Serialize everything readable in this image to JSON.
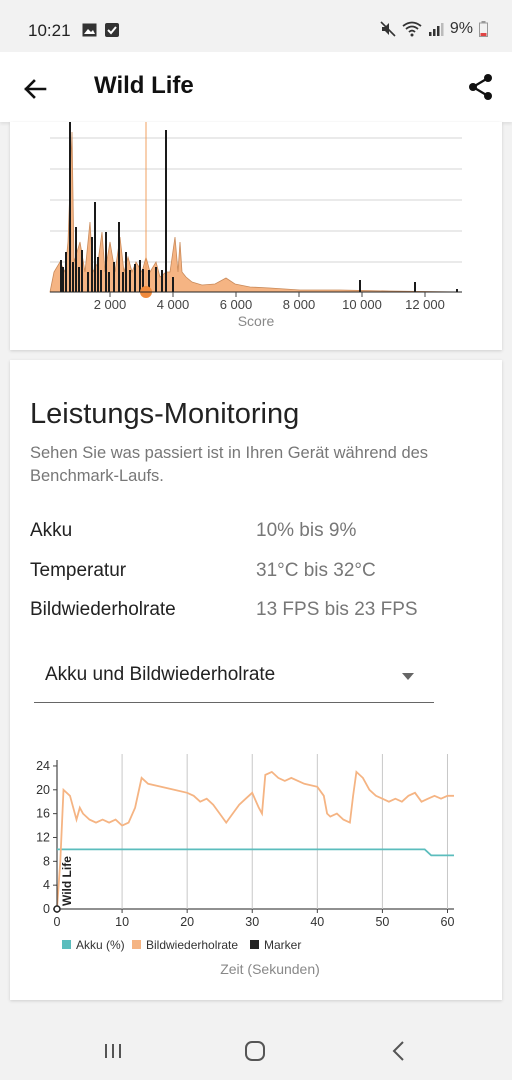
{
  "status_bar": {
    "time": "10:21",
    "battery_pct": "9%"
  },
  "app_bar": {
    "title": "Wild Life"
  },
  "histogram": {
    "x_ticks": [
      "2 000",
      "4 000",
      "6 000",
      "8 000",
      "10 000",
      "12 000"
    ],
    "xlabel": "Score",
    "colors": {
      "fill": "#f5b483",
      "stroke": "#1a1a1a",
      "marker": "#f08a3c"
    }
  },
  "monitoring": {
    "heading": "Leistungs-Monitoring",
    "description": "Sehen Sie was passiert ist in Ihren Gerät während des Benchmark-Laufs.",
    "rows": [
      {
        "label": "Akku",
        "value": "10% bis 9%"
      },
      {
        "label": "Temperatur",
        "value": "31°C bis 32°C"
      },
      {
        "label": "Bildwiederholrate",
        "value": "13 FPS bis 23 FPS"
      }
    ],
    "dropdown_selected": "Akku und Bildwiederholrate"
  },
  "chart_data": {
    "type": "line",
    "xlabel": "Zeit (Sekunden)",
    "x_ticks": [
      "0",
      "10",
      "20",
      "30",
      "40",
      "50",
      "60"
    ],
    "y_ticks": [
      "0",
      "4",
      "8",
      "12",
      "16",
      "20",
      "24"
    ],
    "xlim": [
      0,
      61
    ],
    "ylim": [
      0,
      25
    ],
    "marker_label": "Wild Life",
    "legend": [
      "Akku (%)",
      "Bildwiederholrate",
      "Marker"
    ],
    "colors": {
      "akku": "#5bbdbd",
      "fps": "#f5b483",
      "marker": "#222222"
    },
    "series": [
      {
        "name": "Akku (%)",
        "x": [
          0,
          0.5,
          56.5,
          57.5,
          61
        ],
        "y": [
          10,
          10,
          10,
          9,
          9
        ]
      },
      {
        "name": "Bildwiederholrate",
        "x": [
          0,
          0.5,
          1,
          2,
          3,
          3.5,
          4,
          5,
          6,
          7,
          8,
          9,
          10,
          11,
          12,
          13,
          14,
          16,
          18,
          20,
          21,
          22,
          23,
          24,
          25,
          26,
          27,
          28,
          29,
          30,
          31,
          31.5,
          32,
          33,
          34,
          35,
          36,
          38,
          40,
          41,
          41.5,
          42,
          43,
          44,
          45,
          45.5,
          46,
          47,
          48,
          49,
          50,
          51,
          52,
          53,
          54,
          55,
          56,
          57,
          58,
          59,
          60,
          61
        ],
        "y": [
          0,
          8,
          20,
          19,
          15,
          17,
          16,
          15,
          14.5,
          15,
          14.5,
          15,
          14,
          14.5,
          17,
          22,
          21,
          20.5,
          20,
          19.5,
          19,
          18,
          18.5,
          17.5,
          16,
          14.5,
          16,
          17.5,
          18.5,
          19.5,
          17,
          16,
          22.5,
          23,
          22,
          21.5,
          22,
          21,
          20.5,
          19,
          16,
          15.5,
          16,
          15,
          14.5,
          19,
          23,
          22,
          20,
          19,
          18.5,
          18,
          18.5,
          18,
          19,
          19.5,
          18,
          18.5,
          19,
          18.5,
          19,
          19
        ]
      }
    ],
    "marker_x": 0
  },
  "nav": {
    "recents": "recents",
    "home": "home",
    "back": "back"
  }
}
